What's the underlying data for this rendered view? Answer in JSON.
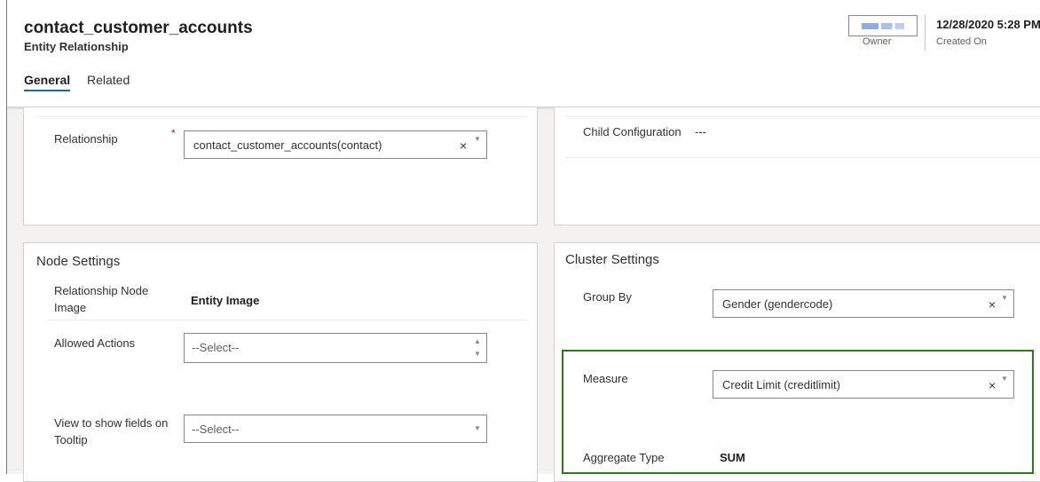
{
  "record": {
    "title": "contact_customer_accounts",
    "entity_type": "Entity Relationship",
    "owner_label": "Owner",
    "created_on_value": "12/28/2020 5:28 PM",
    "created_on_label": "Created On"
  },
  "tabs": [
    {
      "label": "General",
      "active": true
    },
    {
      "label": "Related",
      "active": false
    }
  ],
  "left_top": {
    "relationship_label": "Relationship",
    "required_marker": "*",
    "relationship_value": "contact_customer_accounts(contact)"
  },
  "right_top": {
    "child_config_label": "Child Configuration",
    "child_config_value": "---"
  },
  "node_settings": {
    "title": "Node Settings",
    "node_image_label": "Relationship Node Image",
    "node_image_value": "Entity Image",
    "allowed_actions_label": "Allowed Actions",
    "allowed_actions_placeholder": "--Select--",
    "tooltip_view_label": "View to show fields on Tooltip",
    "tooltip_view_placeholder": "--Select--"
  },
  "cluster_settings": {
    "title": "Cluster Settings",
    "group_by_label": "Group By",
    "group_by_value": "Gender (gendercode)",
    "measure_label": "Measure",
    "measure_value": "Credit Limit (creditlimit)",
    "aggregate_label": "Aggregate Type",
    "aggregate_value": "SUM"
  },
  "icons": {
    "clear": "×",
    "dropdown": "▼",
    "scroll_up": "▲",
    "scroll_down": "▼"
  },
  "colors": {
    "highlight": "#2a7a17",
    "tab_underline": "#0f6cbd",
    "required": "#a4262c"
  }
}
